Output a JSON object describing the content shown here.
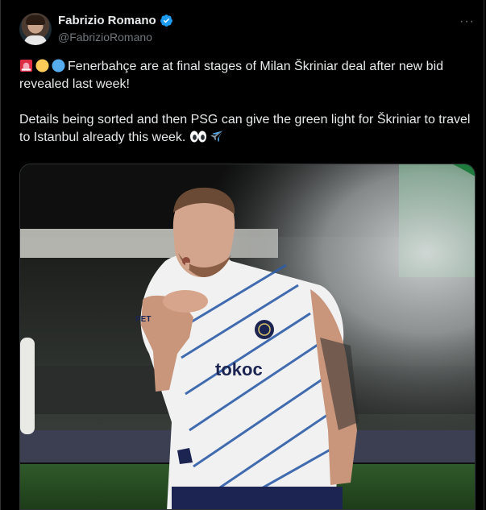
{
  "author": {
    "display_name": "Fabrizio Romano",
    "handle": "@FabrizioRomano",
    "verified": true
  },
  "menu": {
    "icon": "more-horizontal-icon",
    "glyph": "···"
  },
  "tweet": {
    "paragraph1_emojis": [
      "rotating-light-emoji",
      "yellow-circle-emoji",
      "blue-circle-emoji"
    ],
    "paragraph1_text": "Fenerbahçe are at final stages of Milan Škriniar deal after new bid revealed last week!",
    "paragraph2_text": "Details being sorted and then PSG can give the green light for Škriniar to travel to Istanbul already this week.",
    "paragraph2_emojis": [
      "eyes-emoji",
      "airplane-emoji"
    ]
  },
  "media": {
    "alt": "Photo of football player in white and navy striped Fenerbahçe kit blowing a kiss",
    "shirt_sponsor_left": "PET",
    "shirt_sponsor_center": "tokoc"
  },
  "colors": {
    "background": "#000000",
    "text_primary": "#e7e9ea",
    "text_secondary": "#71767b",
    "verified_blue": "#1d9bf0",
    "border": "#2f3336"
  }
}
